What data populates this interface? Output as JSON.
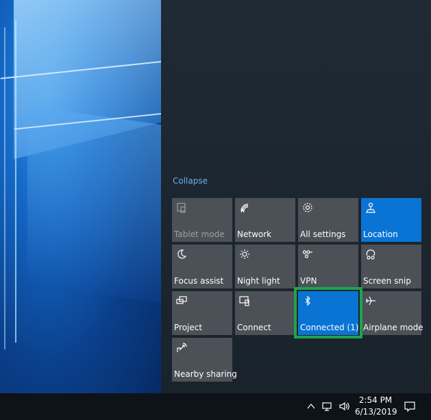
{
  "action_center": {
    "collapse_label": "Collapse",
    "tiles": [
      {
        "label": "Tablet mode",
        "icon": "tablet-mode-icon",
        "state": "disabled"
      },
      {
        "label": "Network",
        "icon": "network-icon",
        "state": "off"
      },
      {
        "label": "All settings",
        "icon": "gear-icon",
        "state": "off"
      },
      {
        "label": "Location",
        "icon": "location-icon",
        "state": "on"
      },
      {
        "label": "Focus assist",
        "icon": "moon-icon",
        "state": "off"
      },
      {
        "label": "Night light",
        "icon": "sun-icon",
        "state": "off"
      },
      {
        "label": "VPN",
        "icon": "vpn-icon",
        "state": "off"
      },
      {
        "label": "Screen snip",
        "icon": "screen-snip-icon",
        "state": "off"
      },
      {
        "label": "Project",
        "icon": "project-icon",
        "state": "off"
      },
      {
        "label": "Connect",
        "icon": "connect-icon",
        "state": "off"
      },
      {
        "label": "Connected (1)",
        "icon": "bluetooth-icon",
        "state": "on"
      },
      {
        "label": "Airplane mode",
        "icon": "airplane-icon",
        "state": "off"
      },
      {
        "label": "Nearby sharing",
        "icon": "nearby-sharing-icon",
        "state": "off"
      }
    ]
  },
  "taskbar": {
    "time": "2:54 PM",
    "date": "6/13/2019",
    "tray_icons": [
      "chevron-up-icon",
      "network-icon",
      "volume-icon",
      "notification-icon"
    ]
  },
  "colors": {
    "tile_off": "#4b5157",
    "tile_on": "#0a74d4",
    "highlight": "#1fa44c",
    "link": "#6fb0ec"
  }
}
